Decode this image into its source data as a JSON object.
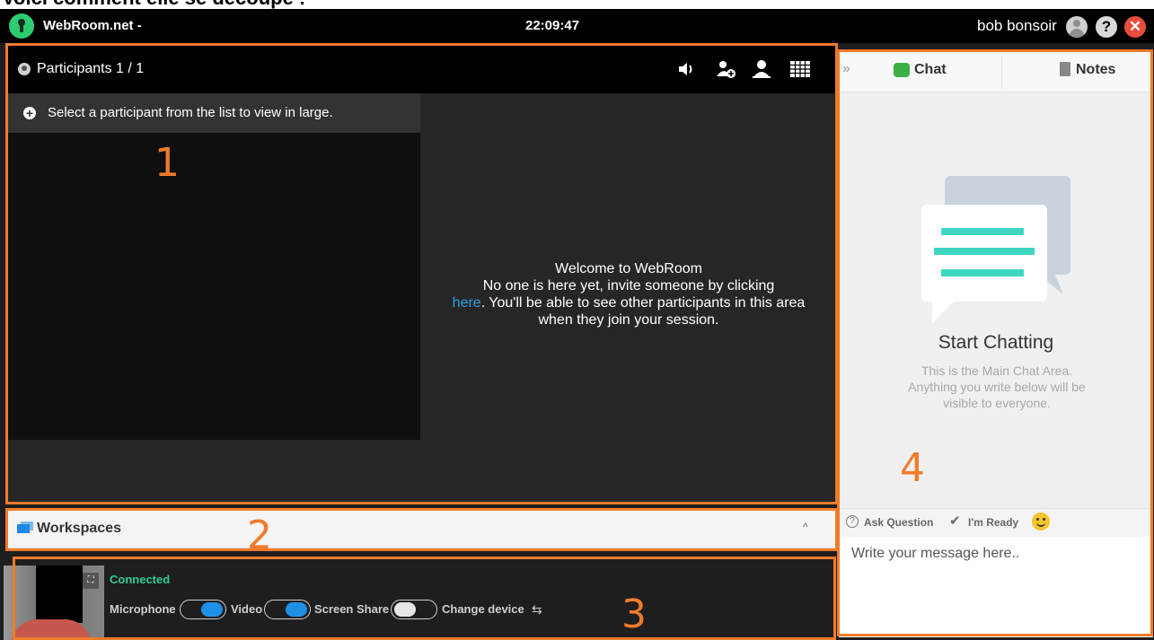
{
  "caption": "Voici comment elle se découpe :",
  "topbar": {
    "app_title": "WebRoom.net -",
    "clock": "22:09:47",
    "username": "bob bonsoir",
    "help": "?",
    "close": "✕"
  },
  "participants": {
    "title": "Participants 1 / 1",
    "select_hint": "Select a participant from the list to view in large.",
    "welcome_line1": "Welcome to WebRoom",
    "welcome_line2": "No one is here yet, invite someone by clicking",
    "welcome_link": "here",
    "welcome_line3": ". You'll be able to see other participants in this area when they join your session."
  },
  "workspaces": {
    "title": "Workspaces",
    "chevron": "^"
  },
  "self": {
    "status": "Connected",
    "microphone_label": "Microphone",
    "microphone_on": true,
    "video_label": "Video",
    "video_on": true,
    "screen_share_label": "Screen Share",
    "screen_share_on": false,
    "change_device_label": "Change device",
    "swap_icon": "⇆"
  },
  "chat": {
    "collapse": "»",
    "tab_chat": "Chat",
    "tab_notes": "Notes",
    "start_title": "Start Chatting",
    "start_sub": "This is the Main Chat Area. Anything you write below will be visible to everyone.",
    "ask_question": "Ask Question",
    "im_ready": "I'm Ready",
    "check": "✔",
    "qmark": "?",
    "input_placeholder": "Write your message here.."
  },
  "annotations": [
    "1",
    "2",
    "3",
    "4"
  ],
  "colors": {
    "accent_orange": "#f07b2b",
    "connected_green": "#2ecc9a",
    "toggle_blue": "#1e90e6",
    "link_blue": "#29a3e6",
    "illustration_teal": "#3fd6c2"
  }
}
